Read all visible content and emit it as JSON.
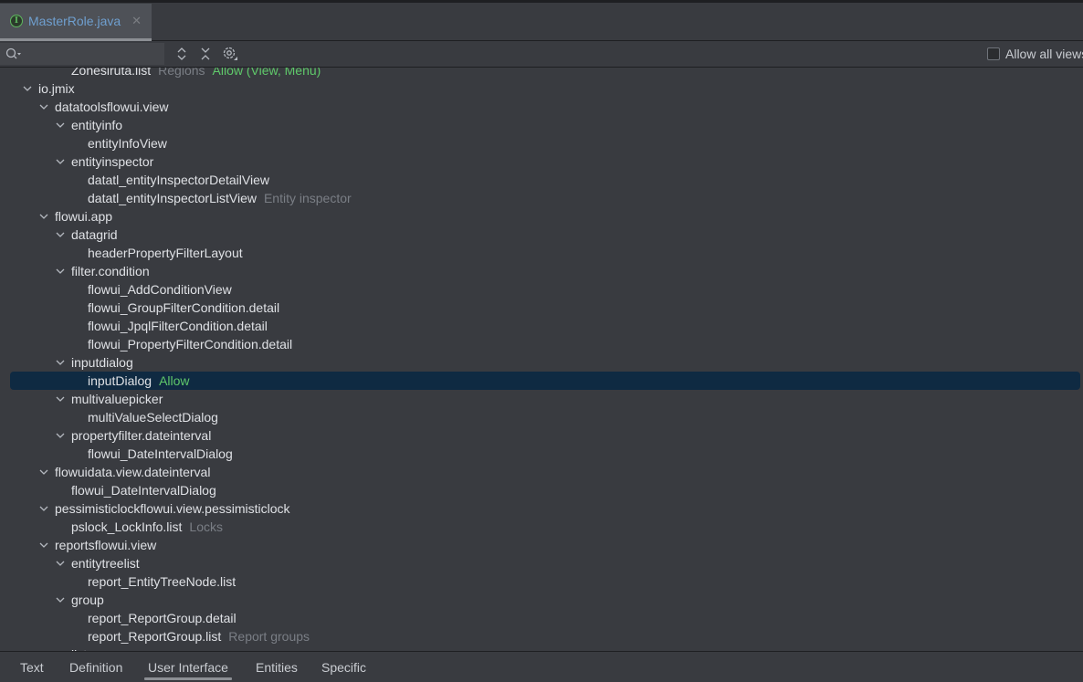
{
  "editor": {
    "tab_title": "MasterRole.java",
    "tab_icon": "interface-icon"
  },
  "toolbar": {
    "search_placeholder": "",
    "search_value": "",
    "expand_all_icon": "expand-icon",
    "collapse_all_icon": "collapse-icon",
    "settings_icon": "gear-icon",
    "allow_all_label": "Allow all views",
    "allow_all_checked": false
  },
  "tree": {
    "rows": [
      {
        "level": 2,
        "name": "Zonesiruta.list",
        "desc": "Regions",
        "perm": "Allow (View, Menu)",
        "expandable": false
      },
      {
        "level": 0,
        "name": "io.jmix",
        "expandable": true
      },
      {
        "level": 1,
        "name": "datatoolsflowui.view",
        "expandable": true
      },
      {
        "level": 2,
        "name": "entityinfo",
        "expandable": true
      },
      {
        "level": 3,
        "name": "entityInfoView",
        "expandable": false
      },
      {
        "level": 2,
        "name": "entityinspector",
        "expandable": true
      },
      {
        "level": 3,
        "name": "datatl_entityInspectorDetailView",
        "expandable": false
      },
      {
        "level": 3,
        "name": "datatl_entityInspectorListView",
        "desc": "Entity inspector",
        "expandable": false
      },
      {
        "level": 1,
        "name": "flowui.app",
        "expandable": true
      },
      {
        "level": 2,
        "name": "datagrid",
        "expandable": true
      },
      {
        "level": 3,
        "name": "headerPropertyFilterLayout",
        "expandable": false
      },
      {
        "level": 2,
        "name": "filter.condition",
        "expandable": true
      },
      {
        "level": 3,
        "name": "flowui_AddConditionView",
        "expandable": false
      },
      {
        "level": 3,
        "name": "flowui_GroupFilterCondition.detail",
        "expandable": false
      },
      {
        "level": 3,
        "name": "flowui_JpqlFilterCondition.detail",
        "expandable": false
      },
      {
        "level": 3,
        "name": "flowui_PropertyFilterCondition.detail",
        "expandable": false
      },
      {
        "level": 2,
        "name": "inputdialog",
        "expandable": true
      },
      {
        "level": 3,
        "name": "inputDialog",
        "perm": "Allow",
        "expandable": false,
        "selected": true
      },
      {
        "level": 2,
        "name": "multivaluepicker",
        "expandable": true
      },
      {
        "level": 3,
        "name": "multiValueSelectDialog",
        "expandable": false
      },
      {
        "level": 2,
        "name": "propertyfilter.dateinterval",
        "expandable": true
      },
      {
        "level": 3,
        "name": "flowui_DateIntervalDialog",
        "expandable": false
      },
      {
        "level": 1,
        "name": "flowuidata.view.dateinterval",
        "expandable": true
      },
      {
        "level": 2,
        "name": "flowui_DateIntervalDialog",
        "expandable": false
      },
      {
        "level": 1,
        "name": "pessimisticlockflowui.view.pessimisticlock",
        "expandable": true
      },
      {
        "level": 2,
        "name": "pslock_LockInfo.list",
        "desc": "Locks",
        "expandable": false
      },
      {
        "level": 1,
        "name": "reportsflowui.view",
        "expandable": true
      },
      {
        "level": 2,
        "name": "entitytreelist",
        "expandable": true
      },
      {
        "level": 3,
        "name": "report_EntityTreeNode.list",
        "expandable": false
      },
      {
        "level": 2,
        "name": "group",
        "expandable": true
      },
      {
        "level": 3,
        "name": "report_ReportGroup.detail",
        "expandable": false
      },
      {
        "level": 3,
        "name": "report_ReportGroup.list",
        "desc": "Report groups",
        "expandable": false
      },
      {
        "level": 2,
        "name": "list",
        "expandable": true
      }
    ]
  },
  "bottom_tabs": [
    {
      "label": "Text",
      "active": false
    },
    {
      "label": "Definition",
      "active": false
    },
    {
      "label": "User Interface",
      "active": true
    },
    {
      "label": "Entities",
      "active": false
    },
    {
      "label": "Specific",
      "active": false
    }
  ],
  "colors": {
    "permission_allow": "#5fc86a",
    "selection": "#0f2a42",
    "description": "#7a7e85",
    "tab_title": "#6f9fcf"
  }
}
